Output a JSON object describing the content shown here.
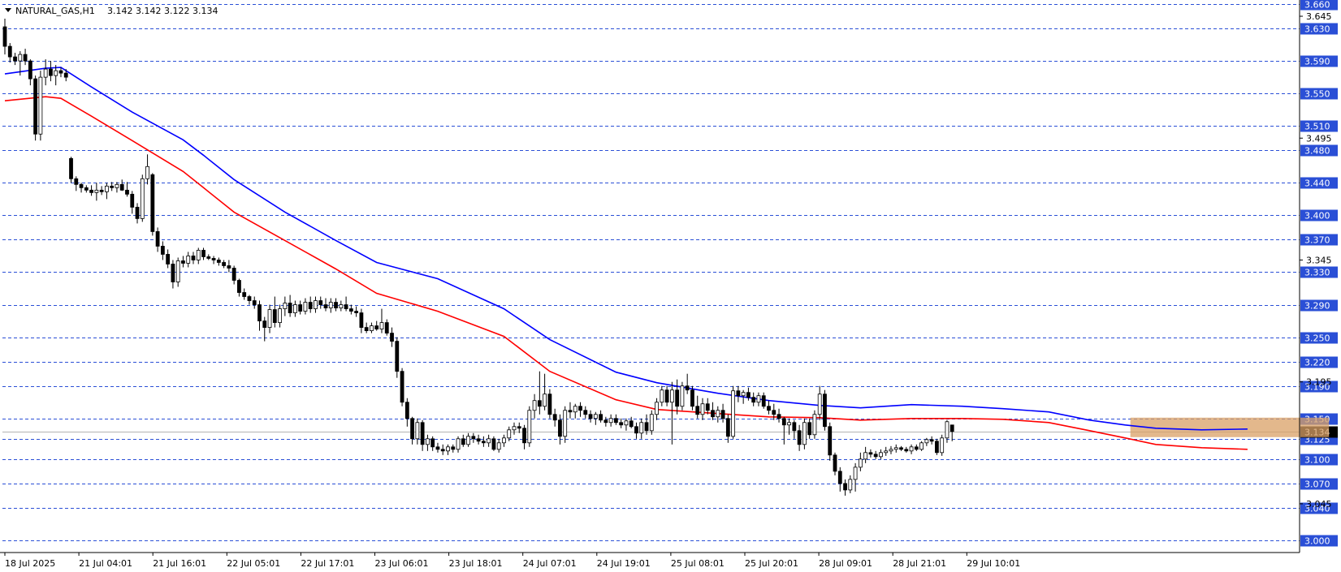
{
  "header": {
    "symbol_label": "NATURAL_GAS,H1",
    "ohlc_label": "3.142 3.142 3.122 3.134"
  },
  "chart_data": {
    "type": "candlestick",
    "symbol": "NATURAL_GAS",
    "timeframe": "H1",
    "ylim": [
      2.985,
      3.665
    ],
    "x_tick_labels": [
      "18 Jul 2025",
      "21 Jul 04:01",
      "21 Jul 16:01",
      "22 Jul 05:01",
      "22 Jul 17:01",
      "23 Jul 06:01",
      "23 Jul 18:01",
      "24 Jul 07:01",
      "24 Jul 19:01",
      "25 Jul 08:01",
      "25 Jul 20:01",
      "28 Jul 09:01",
      "28 Jul 21:01",
      "29 Jul 10:01"
    ],
    "y_tick_labels": [
      "3.645",
      "3.495",
      "3.345",
      "3.195",
      "3.045"
    ],
    "levels": [
      3.66,
      3.63,
      3.59,
      3.55,
      3.51,
      3.48,
      3.44,
      3.4,
      3.37,
      3.33,
      3.29,
      3.25,
      3.22,
      3.19,
      3.15,
      3.125,
      3.1,
      3.07,
      3.04,
      3.0
    ],
    "level_labels": [
      "3.660",
      "3.630",
      "3.590",
      "3.550",
      "3.510",
      "3.480",
      "3.440",
      "3.400",
      "3.370",
      "3.330",
      "3.290",
      "3.250",
      "3.220",
      "3.190",
      "3.150",
      "3.125",
      "3.100",
      "3.070",
      "3.040",
      "3.000"
    ],
    "current_price": 3.134,
    "current_price_label": "3.134",
    "zone": {
      "x_start": 221,
      "x_end": 260,
      "y_low": 3.127,
      "y_high": 3.151
    },
    "ma_blue": [
      [
        0,
        3.574
      ],
      [
        8,
        3.581
      ],
      [
        11,
        3.582
      ],
      [
        17,
        3.558
      ],
      [
        25,
        3.527
      ],
      [
        35,
        3.493
      ],
      [
        39,
        3.474
      ],
      [
        45,
        3.444
      ],
      [
        55,
        3.404
      ],
      [
        65,
        3.369
      ],
      [
        73,
        3.342
      ],
      [
        85,
        3.322
      ],
      [
        98,
        3.285
      ],
      [
        107,
        3.247
      ],
      [
        120,
        3.207
      ],
      [
        128,
        3.194
      ],
      [
        140,
        3.181
      ],
      [
        150,
        3.172
      ],
      [
        160,
        3.166
      ],
      [
        168,
        3.163
      ],
      [
        178,
        3.167
      ],
      [
        188,
        3.165
      ],
      [
        196,
        3.162
      ],
      [
        205,
        3.158
      ],
      [
        213,
        3.148
      ],
      [
        220,
        3.142
      ],
      [
        226,
        3.138
      ],
      [
        235,
        3.136
      ],
      [
        244,
        3.137
      ]
    ],
    "ma_red": [
      [
        0,
        3.541
      ],
      [
        8,
        3.546
      ],
      [
        11,
        3.544
      ],
      [
        17,
        3.522
      ],
      [
        25,
        3.492
      ],
      [
        35,
        3.454
      ],
      [
        39,
        3.434
      ],
      [
        45,
        3.404
      ],
      [
        55,
        3.369
      ],
      [
        65,
        3.334
      ],
      [
        73,
        3.304
      ],
      [
        85,
        3.282
      ],
      [
        98,
        3.251
      ],
      [
        107,
        3.208
      ],
      [
        120,
        3.173
      ],
      [
        128,
        3.161
      ],
      [
        140,
        3.156
      ],
      [
        150,
        3.152
      ],
      [
        160,
        3.151
      ],
      [
        168,
        3.148
      ],
      [
        178,
        3.15
      ],
      [
        188,
        3.15
      ],
      [
        196,
        3.149
      ],
      [
        205,
        3.145
      ],
      [
        213,
        3.135
      ],
      [
        220,
        3.126
      ],
      [
        226,
        3.118
      ],
      [
        235,
        3.114
      ],
      [
        244,
        3.112
      ]
    ],
    "candles": [
      [
        3.632,
        3.642,
        3.598,
        3.608
      ],
      [
        3.608,
        3.612,
        3.588,
        3.595
      ],
      [
        3.595,
        3.6,
        3.585,
        3.59
      ],
      [
        3.59,
        3.602,
        3.572,
        3.598
      ],
      [
        3.598,
        3.605,
        3.585,
        3.59
      ],
      [
        3.59,
        3.592,
        3.56,
        3.568
      ],
      [
        3.568,
        3.572,
        3.492,
        3.5
      ],
      [
        3.5,
        3.578,
        3.492,
        3.57
      ],
      [
        3.57,
        3.592,
        3.56,
        3.58
      ],
      [
        3.58,
        3.59,
        3.565,
        3.572
      ],
      [
        3.572,
        3.585,
        3.56,
        3.578
      ],
      [
        3.578,
        3.582,
        3.57,
        3.575
      ],
      [
        3.575,
        3.58,
        3.565,
        3.57
      ],
      [
        3.47,
        3.472,
        3.44,
        3.445
      ],
      [
        3.445,
        3.448,
        3.43,
        3.438
      ],
      [
        3.438,
        3.44,
        3.428,
        3.434
      ],
      [
        3.434,
        3.437,
        3.428,
        3.431
      ],
      [
        3.431,
        3.437,
        3.424,
        3.428
      ],
      [
        3.428,
        3.44,
        3.418,
        3.431
      ],
      [
        3.431,
        3.436,
        3.425,
        3.429
      ],
      [
        3.429,
        3.44,
        3.42,
        3.436
      ],
      [
        3.436,
        3.441,
        3.43,
        3.434
      ],
      [
        3.434,
        3.441,
        3.428,
        3.438
      ],
      [
        3.438,
        3.444,
        3.43,
        3.431
      ],
      [
        3.431,
        3.441,
        3.423,
        3.426
      ],
      [
        3.426,
        3.43,
        3.402,
        3.41
      ],
      [
        3.41,
        3.415,
        3.39,
        3.396
      ],
      [
        3.396,
        3.45,
        3.392,
        3.445
      ],
      [
        3.445,
        3.475,
        3.438,
        3.46
      ],
      [
        3.45,
        3.452,
        3.375,
        3.38
      ],
      [
        3.38,
        3.385,
        3.355,
        3.362
      ],
      [
        3.362,
        3.368,
        3.345,
        3.352
      ],
      [
        3.352,
        3.358,
        3.335,
        3.34
      ],
      [
        3.34,
        3.345,
        3.31,
        3.318
      ],
      [
        3.318,
        3.348,
        3.312,
        3.344
      ],
      [
        3.344,
        3.35,
        3.336,
        3.341
      ],
      [
        3.341,
        3.355,
        3.336,
        3.35
      ],
      [
        3.35,
        3.355,
        3.34,
        3.345
      ],
      [
        3.345,
        3.36,
        3.34,
        3.357
      ],
      [
        3.357,
        3.36,
        3.345,
        3.349
      ],
      [
        3.349,
        3.352,
        3.345,
        3.347
      ],
      [
        3.347,
        3.35,
        3.34,
        3.345
      ],
      [
        3.345,
        3.348,
        3.338,
        3.342
      ],
      [
        3.342,
        3.345,
        3.335,
        3.338
      ],
      [
        3.338,
        3.345,
        3.33,
        3.335
      ],
      [
        3.335,
        3.338,
        3.315,
        3.32
      ],
      [
        3.32,
        3.322,
        3.3,
        3.305
      ],
      [
        3.305,
        3.31,
        3.296,
        3.3
      ],
      [
        3.3,
        3.302,
        3.29,
        3.295
      ],
      [
        3.295,
        3.3,
        3.285,
        3.29
      ],
      [
        3.29,
        3.295,
        3.258,
        3.27
      ],
      [
        3.27,
        3.275,
        3.245,
        3.262
      ],
      [
        3.262,
        3.29,
        3.255,
        3.284
      ],
      [
        3.284,
        3.3,
        3.262,
        3.268
      ],
      [
        3.268,
        3.29,
        3.262,
        3.285
      ],
      [
        3.285,
        3.3,
        3.276,
        3.292
      ],
      [
        3.292,
        3.302,
        3.275,
        3.28
      ],
      [
        3.28,
        3.295,
        3.275,
        3.29
      ],
      [
        3.29,
        3.295,
        3.278,
        3.282
      ],
      [
        3.282,
        3.298,
        3.278,
        3.293
      ],
      [
        3.293,
        3.3,
        3.28,
        3.285
      ],
      [
        3.285,
        3.3,
        3.28,
        3.295
      ],
      [
        3.295,
        3.3,
        3.285,
        3.29
      ],
      [
        3.29,
        3.298,
        3.282,
        3.286
      ],
      [
        3.286,
        3.298,
        3.28,
        3.293
      ],
      [
        3.293,
        3.298,
        3.282,
        3.286
      ],
      [
        3.286,
        3.295,
        3.282,
        3.29
      ],
      [
        3.29,
        3.3,
        3.282,
        3.285
      ],
      [
        3.285,
        3.29,
        3.278,
        3.282
      ],
      [
        3.282,
        3.288,
        3.275,
        3.28
      ],
      [
        3.28,
        3.285,
        3.255,
        3.262
      ],
      [
        3.262,
        3.268,
        3.255,
        3.258
      ],
      [
        3.258,
        3.268,
        3.255,
        3.264
      ],
      [
        3.264,
        3.27,
        3.258,
        3.26
      ],
      [
        3.26,
        3.285,
        3.255,
        3.268
      ],
      [
        3.268,
        3.272,
        3.252,
        3.255
      ],
      [
        3.255,
        3.262,
        3.238,
        3.245
      ],
      [
        3.245,
        3.25,
        3.2,
        3.208
      ],
      [
        3.208,
        3.212,
        3.165,
        3.17
      ],
      [
        3.17,
        3.175,
        3.14,
        3.15
      ],
      [
        3.15,
        3.152,
        3.118,
        3.125
      ],
      [
        3.125,
        3.15,
        3.118,
        3.145
      ],
      [
        3.145,
        3.148,
        3.11,
        3.118
      ],
      [
        3.118,
        3.13,
        3.11,
        3.125
      ],
      [
        3.125,
        3.128,
        3.11,
        3.115
      ],
      [
        3.115,
        3.12,
        3.108,
        3.112
      ],
      [
        3.112,
        3.118,
        3.105,
        3.11
      ],
      [
        3.11,
        3.118,
        3.105,
        3.115
      ],
      [
        3.115,
        3.118,
        3.108,
        3.112
      ],
      [
        3.112,
        3.128,
        3.108,
        3.125
      ],
      [
        3.125,
        3.13,
        3.115,
        3.118
      ],
      [
        3.118,
        3.132,
        3.115,
        3.128
      ],
      [
        3.128,
        3.132,
        3.12,
        3.125
      ],
      [
        3.125,
        3.13,
        3.118,
        3.122
      ],
      [
        3.122,
        3.128,
        3.115,
        3.12
      ],
      [
        3.12,
        3.13,
        3.115,
        3.125
      ],
      [
        3.125,
        3.128,
        3.11,
        3.112
      ],
      [
        3.112,
        3.125,
        3.108,
        3.12
      ],
      [
        3.12,
        3.13,
        3.115,
        3.126
      ],
      [
        3.126,
        3.14,
        3.122,
        3.136
      ],
      [
        3.136,
        3.145,
        3.13,
        3.14
      ],
      [
        3.14,
        3.145,
        3.132,
        3.138
      ],
      [
        3.138,
        3.142,
        3.112,
        3.12
      ],
      [
        3.12,
        3.165,
        3.115,
        3.16
      ],
      [
        3.16,
        3.18,
        3.15,
        3.172
      ],
      [
        3.172,
        3.208,
        3.155,
        3.165
      ],
      [
        3.165,
        3.205,
        3.16,
        3.18
      ],
      [
        3.18,
        3.186,
        3.15,
        3.155
      ],
      [
        3.155,
        3.162,
        3.14,
        3.148
      ],
      [
        3.148,
        3.155,
        3.118,
        3.128
      ],
      [
        3.128,
        3.165,
        3.12,
        3.16
      ],
      [
        3.16,
        3.17,
        3.15,
        3.158
      ],
      [
        3.158,
        3.168,
        3.15,
        3.165
      ],
      [
        3.165,
        3.17,
        3.152,
        3.16
      ],
      [
        3.16,
        3.165,
        3.15,
        3.155
      ],
      [
        3.155,
        3.16,
        3.145,
        3.15
      ],
      [
        3.15,
        3.158,
        3.142,
        3.155
      ],
      [
        3.155,
        3.16,
        3.145,
        3.148
      ],
      [
        3.148,
        3.152,
        3.14,
        3.145
      ],
      [
        3.145,
        3.155,
        3.14,
        3.15
      ],
      [
        3.15,
        3.155,
        3.142,
        3.145
      ],
      [
        3.145,
        3.15,
        3.138,
        3.142
      ],
      [
        3.142,
        3.15,
        3.135,
        3.147
      ],
      [
        3.147,
        3.152,
        3.138,
        3.14
      ],
      [
        3.14,
        3.145,
        3.125,
        3.132
      ],
      [
        3.132,
        3.15,
        3.125,
        3.145
      ],
      [
        3.145,
        3.155,
        3.13,
        3.135
      ],
      [
        3.135,
        3.16,
        3.13,
        3.155
      ],
      [
        3.155,
        3.175,
        3.148,
        3.17
      ],
      [
        3.17,
        3.19,
        3.165,
        3.185
      ],
      [
        3.185,
        3.19,
        3.165,
        3.17
      ],
      [
        3.17,
        3.195,
        3.118,
        3.185
      ],
      [
        3.185,
        3.198,
        3.155,
        3.165
      ],
      [
        3.165,
        3.195,
        3.16,
        3.19
      ],
      [
        3.19,
        3.205,
        3.18,
        3.185
      ],
      [
        3.185,
        3.19,
        3.16,
        3.165
      ],
      [
        3.165,
        3.178,
        3.15,
        3.155
      ],
      [
        3.155,
        3.175,
        3.148,
        3.168
      ],
      [
        3.168,
        3.175,
        3.155,
        3.16
      ],
      [
        3.16,
        3.17,
        3.148,
        3.152
      ],
      [
        3.152,
        3.165,
        3.145,
        3.16
      ],
      [
        3.16,
        3.168,
        3.145,
        3.15
      ],
      [
        3.15,
        3.155,
        3.12,
        3.128
      ],
      [
        3.128,
        3.19,
        3.125,
        3.184
      ],
      [
        3.184,
        3.19,
        3.17,
        3.178
      ],
      [
        3.178,
        3.185,
        3.168,
        3.182
      ],
      [
        3.182,
        3.188,
        3.172,
        3.176
      ],
      [
        3.176,
        3.182,
        3.165,
        3.17
      ],
      [
        3.17,
        3.182,
        3.165,
        3.178
      ],
      [
        3.178,
        3.182,
        3.162,
        3.165
      ],
      [
        3.165,
        3.172,
        3.155,
        3.16
      ],
      [
        3.16,
        3.168,
        3.148,
        3.155
      ],
      [
        3.155,
        3.162,
        3.145,
        3.15
      ],
      [
        3.15,
        3.152,
        3.118,
        3.142
      ],
      [
        3.142,
        3.15,
        3.13,
        3.145
      ],
      [
        3.145,
        3.148,
        3.125,
        3.135
      ],
      [
        3.135,
        3.142,
        3.11,
        3.118
      ],
      [
        3.118,
        3.15,
        3.112,
        3.145
      ],
      [
        3.145,
        3.15,
        3.125,
        3.13
      ],
      [
        3.13,
        3.16,
        3.125,
        3.155
      ],
      [
        3.155,
        3.19,
        3.148,
        3.18
      ],
      [
        3.18,
        3.185,
        3.135,
        3.14
      ],
      [
        3.14,
        3.145,
        3.098,
        3.105
      ],
      [
        3.105,
        3.108,
        3.08,
        3.085
      ],
      [
        3.085,
        3.09,
        3.06,
        3.07
      ],
      [
        3.07,
        3.075,
        3.055,
        3.062
      ],
      [
        3.062,
        3.08,
        3.058,
        3.075
      ],
      [
        3.075,
        3.095,
        3.06,
        3.09
      ],
      [
        3.09,
        3.108,
        3.085,
        3.1
      ],
      [
        3.1,
        3.115,
        3.095,
        3.108
      ],
      [
        3.108,
        3.112,
        3.102,
        3.106
      ],
      [
        3.106,
        3.11,
        3.1,
        3.103
      ],
      [
        3.103,
        3.112,
        3.1,
        3.108
      ],
      [
        3.108,
        3.115,
        3.104,
        3.11
      ],
      [
        3.11,
        3.116,
        3.106,
        3.112
      ],
      [
        3.112,
        3.118,
        3.108,
        3.114
      ],
      [
        3.114,
        3.116,
        3.11,
        3.112
      ],
      [
        3.112,
        3.115,
        3.108,
        3.11
      ],
      [
        3.11,
        3.118,
        3.106,
        3.115
      ],
      [
        3.115,
        3.118,
        3.11,
        3.112
      ],
      [
        3.112,
        3.122,
        3.11,
        3.12
      ],
      [
        3.12,
        3.126,
        3.116,
        3.124
      ],
      [
        3.124,
        3.128,
        3.118,
        3.122
      ],
      [
        3.122,
        3.125,
        3.105,
        3.108
      ],
      [
        3.108,
        3.13,
        3.104,
        3.126
      ],
      [
        3.126,
        3.148,
        3.12,
        3.146
      ],
      [
        3.142,
        3.142,
        3.122,
        3.134
      ]
    ]
  }
}
